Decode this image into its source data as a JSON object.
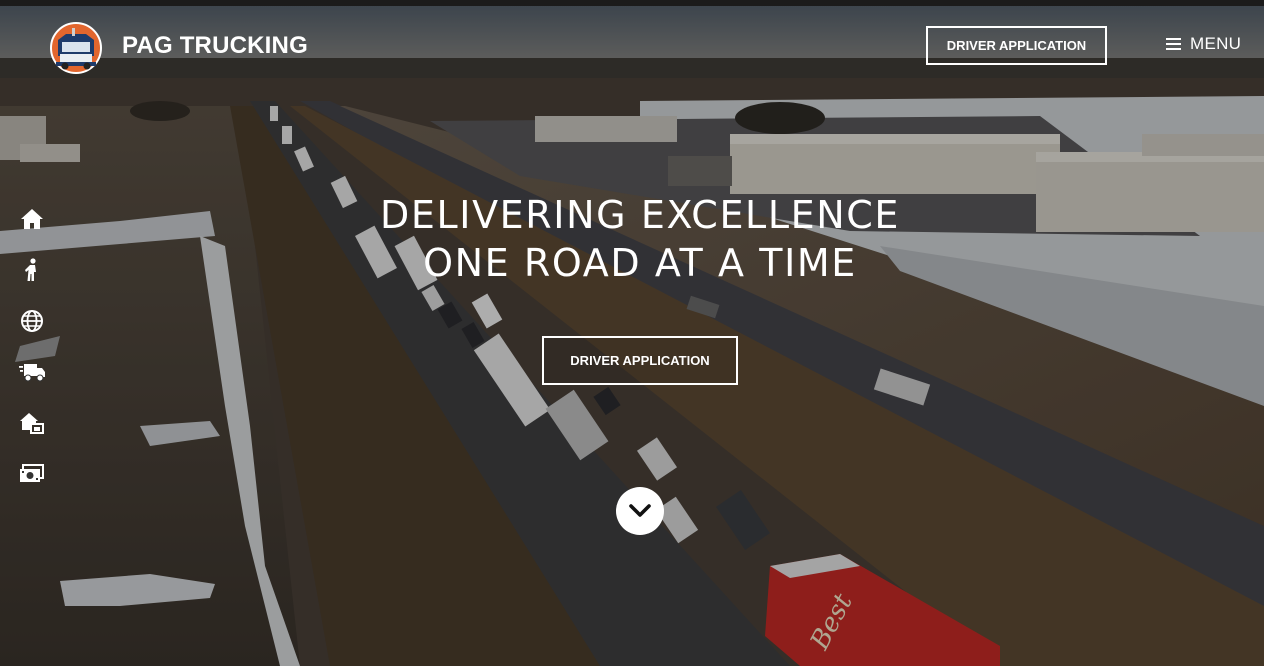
{
  "brand": {
    "name": "PAG TRUCKING",
    "logo_icon": "semi-truck-logo-icon"
  },
  "header": {
    "cta_label": "DRIVER APPLICATION",
    "menu_label": "MENU",
    "menu_icon": "hamburger-icon"
  },
  "siderail": {
    "items": [
      {
        "icon": "home-icon"
      },
      {
        "icon": "person-walking-icon"
      },
      {
        "icon": "globe-icon"
      },
      {
        "icon": "truck-fast-icon"
      },
      {
        "icon": "house-building-icon"
      },
      {
        "icon": "money-bill-icon"
      }
    ]
  },
  "hero": {
    "title_line1": "DELIVERING EXCELLENCE",
    "title_line2": "ONE ROAD AT A TIME",
    "cta_label": "DRIVER APPLICATION",
    "scroll_icon": "chevron-down-icon"
  },
  "background": {
    "description_colors": {
      "accent": "#ffffff",
      "overlay": "#000000",
      "trailer_red": "#c52a26"
    },
    "trailer_text": "Best"
  }
}
